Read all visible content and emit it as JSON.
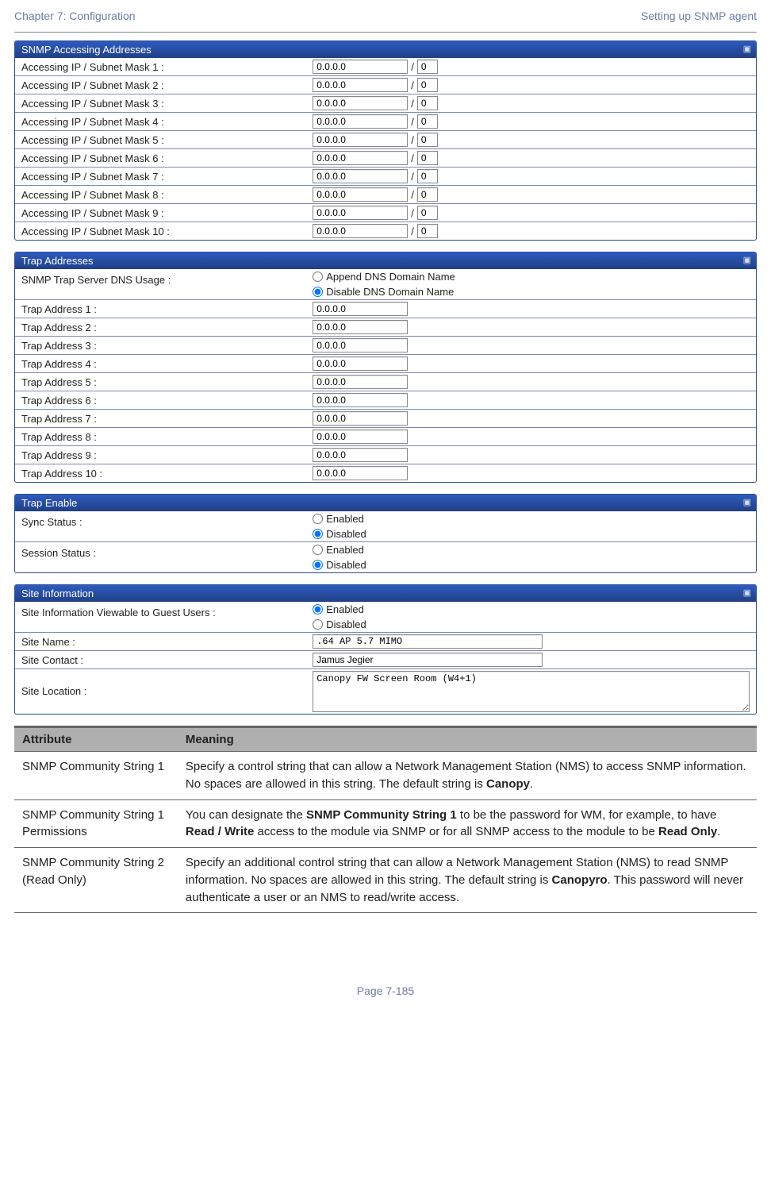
{
  "header": {
    "left": "Chapter 7:  Configuration",
    "right": "Setting up SNMP agent"
  },
  "snmp_accessing": {
    "title": "SNMP Accessing Addresses",
    "rows": [
      {
        "label": "Accessing IP / Subnet Mask 1 :",
        "ip": "0.0.0.0",
        "mask": "0"
      },
      {
        "label": "Accessing IP / Subnet Mask 2 :",
        "ip": "0.0.0.0",
        "mask": "0"
      },
      {
        "label": "Accessing IP / Subnet Mask 3 :",
        "ip": "0.0.0.0",
        "mask": "0"
      },
      {
        "label": "Accessing IP / Subnet Mask 4 :",
        "ip": "0.0.0.0",
        "mask": "0"
      },
      {
        "label": "Accessing IP / Subnet Mask 5 :",
        "ip": "0.0.0.0",
        "mask": "0"
      },
      {
        "label": "Accessing IP / Subnet Mask 6 :",
        "ip": "0.0.0.0",
        "mask": "0"
      },
      {
        "label": "Accessing IP / Subnet Mask 7 :",
        "ip": "0.0.0.0",
        "mask": "0"
      },
      {
        "label": "Accessing IP / Subnet Mask 8 :",
        "ip": "0.0.0.0",
        "mask": "0"
      },
      {
        "label": "Accessing IP / Subnet Mask 9 :",
        "ip": "0.0.0.0",
        "mask": "0"
      },
      {
        "label": "Accessing IP / Subnet Mask 10 :",
        "ip": "0.0.0.0",
        "mask": "0"
      }
    ]
  },
  "trap_addresses": {
    "title": "Trap Addresses",
    "dns_usage": {
      "label": "SNMP Trap Server DNS Usage :",
      "option_append": "Append DNS Domain Name",
      "option_disable": "Disable DNS Domain Name",
      "selected": "disable"
    },
    "rows": [
      {
        "label": "Trap Address 1 :",
        "ip": "0.0.0.0"
      },
      {
        "label": "Trap Address 2 :",
        "ip": "0.0.0.0"
      },
      {
        "label": "Trap Address 3 :",
        "ip": "0.0.0.0"
      },
      {
        "label": "Trap Address 4 :",
        "ip": "0.0.0.0"
      },
      {
        "label": "Trap Address 5 :",
        "ip": "0.0.0.0"
      },
      {
        "label": "Trap Address 6 :",
        "ip": "0.0.0.0"
      },
      {
        "label": "Trap Address 7 :",
        "ip": "0.0.0.0"
      },
      {
        "label": "Trap Address 8 :",
        "ip": "0.0.0.0"
      },
      {
        "label": "Trap Address 9 :",
        "ip": "0.0.0.0"
      },
      {
        "label": "Trap Address 10 :",
        "ip": "0.0.0.0"
      }
    ]
  },
  "trap_enable": {
    "title": "Trap Enable",
    "sync_status": {
      "label": "Sync Status :",
      "enabled": "Enabled",
      "disabled": "Disabled",
      "selected": "disabled"
    },
    "session_status": {
      "label": "Session Status :",
      "enabled": "Enabled",
      "disabled": "Disabled",
      "selected": "disabled"
    }
  },
  "site_info": {
    "title": "Site Information",
    "viewable": {
      "label": "Site Information Viewable to Guest Users :",
      "enabled": "Enabled",
      "disabled": "Disabled",
      "selected": "enabled"
    },
    "site_name": {
      "label": "Site Name :",
      "value": ".64 AP 5.7 MIMO"
    },
    "site_contact": {
      "label": "Site Contact :",
      "value": "Jamus Jegier"
    },
    "site_location": {
      "label": "Site Location :",
      "value": "Canopy FW Screen Room (W4+1)"
    }
  },
  "attr_table": {
    "header_attr": "Attribute",
    "header_meaning": "Meaning",
    "rows": [
      {
        "attr": "SNMP Community String 1",
        "meaning_pre": "Specify a control string that can allow a Network Management Station (NMS) to access SNMP information. No spaces are allowed in this string. The default string is ",
        "b1": "Canopy",
        "meaning_post": "."
      },
      {
        "attr": "SNMP Community String 1 Permissions",
        "meaning_pre": "You can designate the ",
        "b1": "SNMP Community String 1",
        "mid1": " to be the password for WM, for example, to have ",
        "b2": "Read / Write",
        "mid2": " access to the module via SNMP or for all SNMP access to the module to be ",
        "b3": "Read Only",
        "meaning_post": "."
      },
      {
        "attr": "SNMP Community String 2 (Read Only)",
        "meaning_pre": "Specify an additional control string that can allow a Network Management Station (NMS) to read SNMP information. No spaces are allowed in this string. The default string is ",
        "b1": "Canopyro",
        "meaning_post": ". This password will never authenticate a user or an NMS to read/write access."
      }
    ]
  },
  "footer": "Page 7-185"
}
